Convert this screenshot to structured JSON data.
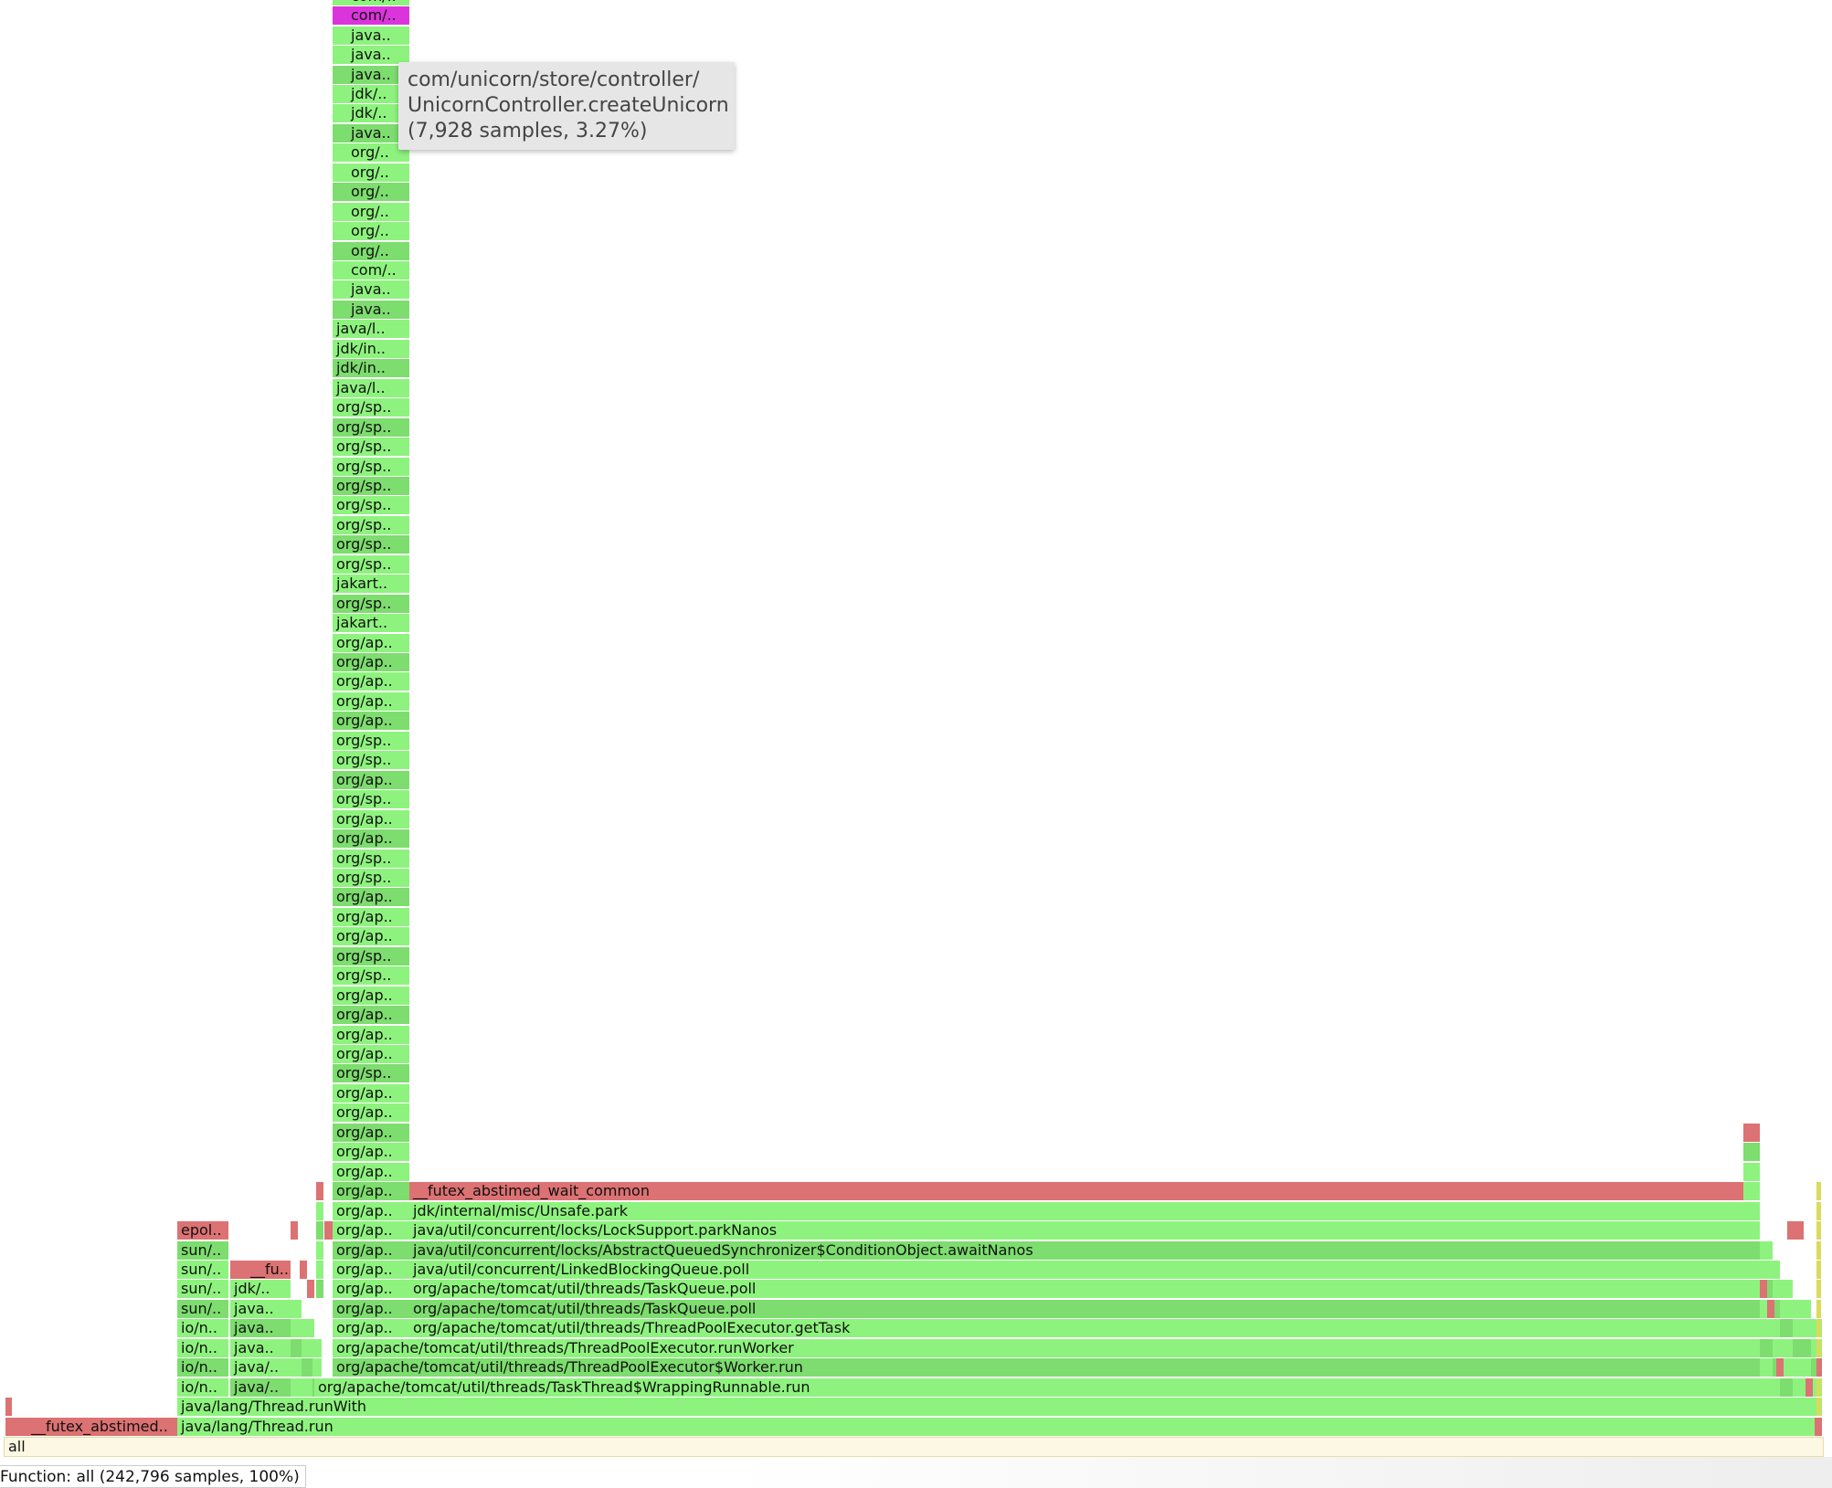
{
  "colors": {
    "green_a": "#8ef37e",
    "green_b": "#7ddd6e",
    "red": "#dc7273",
    "magenta": "#dc34dd",
    "yellow": "#dada5d",
    "root_bg": "#fdf8e3"
  },
  "root_label": "all",
  "tooltip": {
    "line1": "com/unicorn/store/controller/",
    "line2": "UnicornController.createUnicorn",
    "line3": "(7,928 samples, 3.27%)"
  },
  "status": "Function: all (242,796 samples, 100%)",
  "flamegraph": {
    "tall_stack_bottom_up": [
      "org/ap..",
      "org/ap..",
      "org/ap..",
      "org/ap..",
      "org/ap..",
      "org/ap..",
      "org/ap..",
      "org/ap..",
      "org/ap..",
      "org/ap..",
      "org/ap..",
      "org/ap..",
      "org/ap..",
      "org/sp..",
      "org/ap..",
      "org/ap..",
      "org/ap..",
      "org/ap..",
      "org/sp..",
      "org/sp..",
      "org/ap..",
      "org/ap..",
      "org/ap..",
      "org/sp..",
      "org/sp..",
      "org/ap..",
      "org/ap..",
      "org/sp..",
      "org/ap..",
      "org/sp..",
      "org/sp..",
      "org/ap..",
      "org/ap..",
      "org/ap..",
      "org/ap..",
      "org/ap..",
      "jakart..",
      "org/sp..",
      "jakart..",
      "org/sp..",
      "org/sp..",
      "org/sp..",
      "org/sp..",
      "org/sp..",
      "org/sp..",
      "org/sp..",
      "org/sp..",
      "org/sp..",
      "java/l..",
      "jdk/in..",
      "jdk/in..",
      "java/l..",
      "java..",
      "java..",
      "com/..",
      "org/..",
      "org/..",
      "org/..",
      "org/..",
      "org/..",
      "org/..",
      "java..",
      "jdk/..",
      "jdk/..",
      "java..",
      "java..",
      "java..",
      "com/..",
      "com/.."
    ],
    "right_stack": [
      "__futex_abstimed_wait_common",
      "jdk/internal/misc/Unsafe.park",
      "java/util/concurrent/locks/LockSupport.parkNanos",
      "java/util/concurrent/locks/AbstractQueuedSynchronizer$ConditionObject.awaitNanos",
      "java/util/concurrent/LinkedBlockingQueue.poll",
      "org/apache/tomcat/util/threads/TaskQueue.poll",
      "org/apache/tomcat/util/threads/TaskQueue.poll",
      "org/apache/tomcat/util/threads/ThreadPoolExecutor.getTask"
    ],
    "shared_frames": {
      "run_worker": "org/apache/tomcat/util/threads/ThreadPoolExecutor.runWorker",
      "worker_run": "org/apache/tomcat/util/threads/ThreadPoolExecutor$Worker.run",
      "wrapping_run": "org/apache/tomcat/util/threads/TaskThread$WrappingRunnable.run",
      "run_with": "java/lang/Thread.runWith",
      "thread_run": "java/lang/Thread.run",
      "futex_left": "__futex_abstimed.."
    },
    "col_a": [
      "io/n..",
      "io/n..",
      "io/n..",
      "io/n..",
      "sun/..",
      "sun/..",
      "sun/..",
      "sun/..",
      "epol.."
    ],
    "col_b": [
      "java/..",
      "java/..",
      "java..",
      "java..",
      "java..",
      "jdk/..",
      "__fu.."
    ]
  }
}
